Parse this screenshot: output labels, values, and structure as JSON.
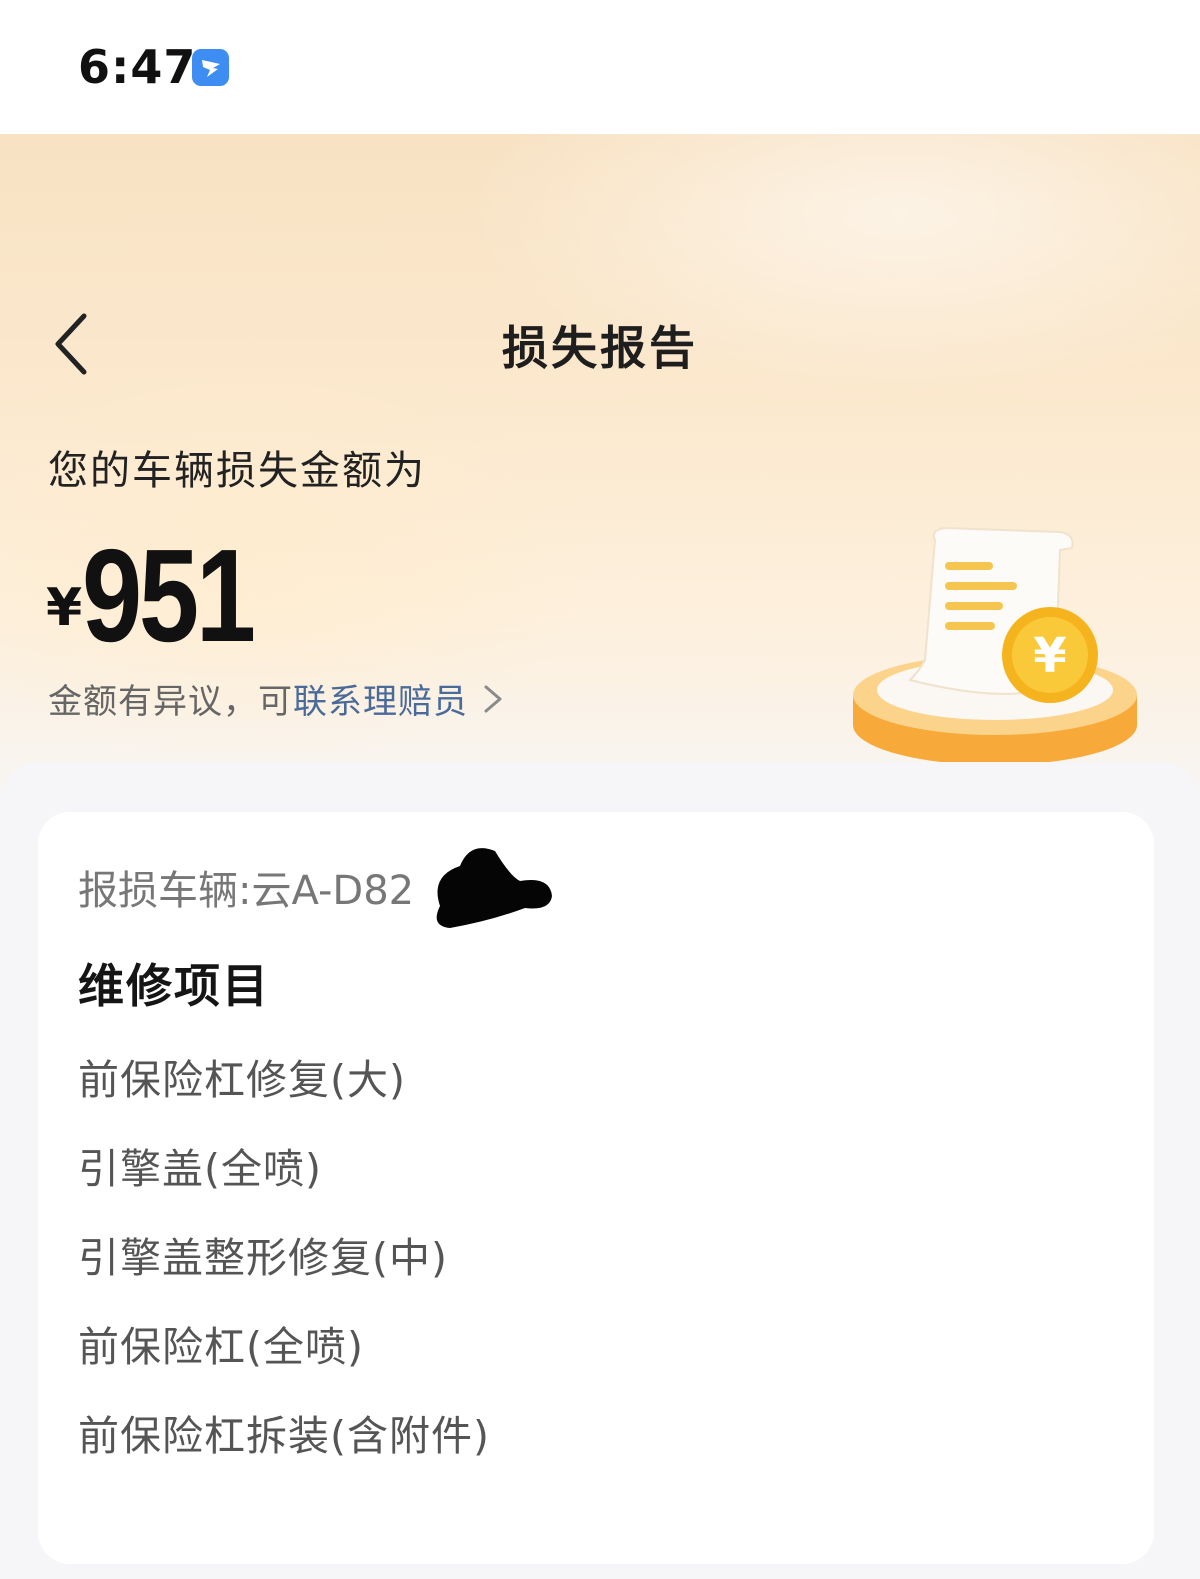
{
  "status_bar": {
    "time": "6:47",
    "app_icon": "dingtalk-style-icon"
  },
  "header": {
    "back_icon": "chevron-left-icon",
    "title": "损失报告"
  },
  "summary": {
    "label": "您的车辆损失金额为",
    "currency_symbol": "¥",
    "amount": "951",
    "dispute_text": "金额有异议，可",
    "contact_link": "联系理赔员",
    "contact_icon": "chevron-right-icon",
    "illustration": "receipt-coin-illustration"
  },
  "report": {
    "vehicle_label": "报损车辆:云A-D82",
    "section_title": "维修项目",
    "items": [
      "前保险杠修复(大)",
      "引擎盖(全喷)",
      "引擎盖整形修复(中)",
      "前保险杠(全喷)",
      "前保险杠拆装(含附件)"
    ]
  },
  "colors": {
    "accent_link": "#4a6b9a",
    "hero_gradient_top": "#f8e2c3",
    "coin_gold": "#f5b41e"
  }
}
